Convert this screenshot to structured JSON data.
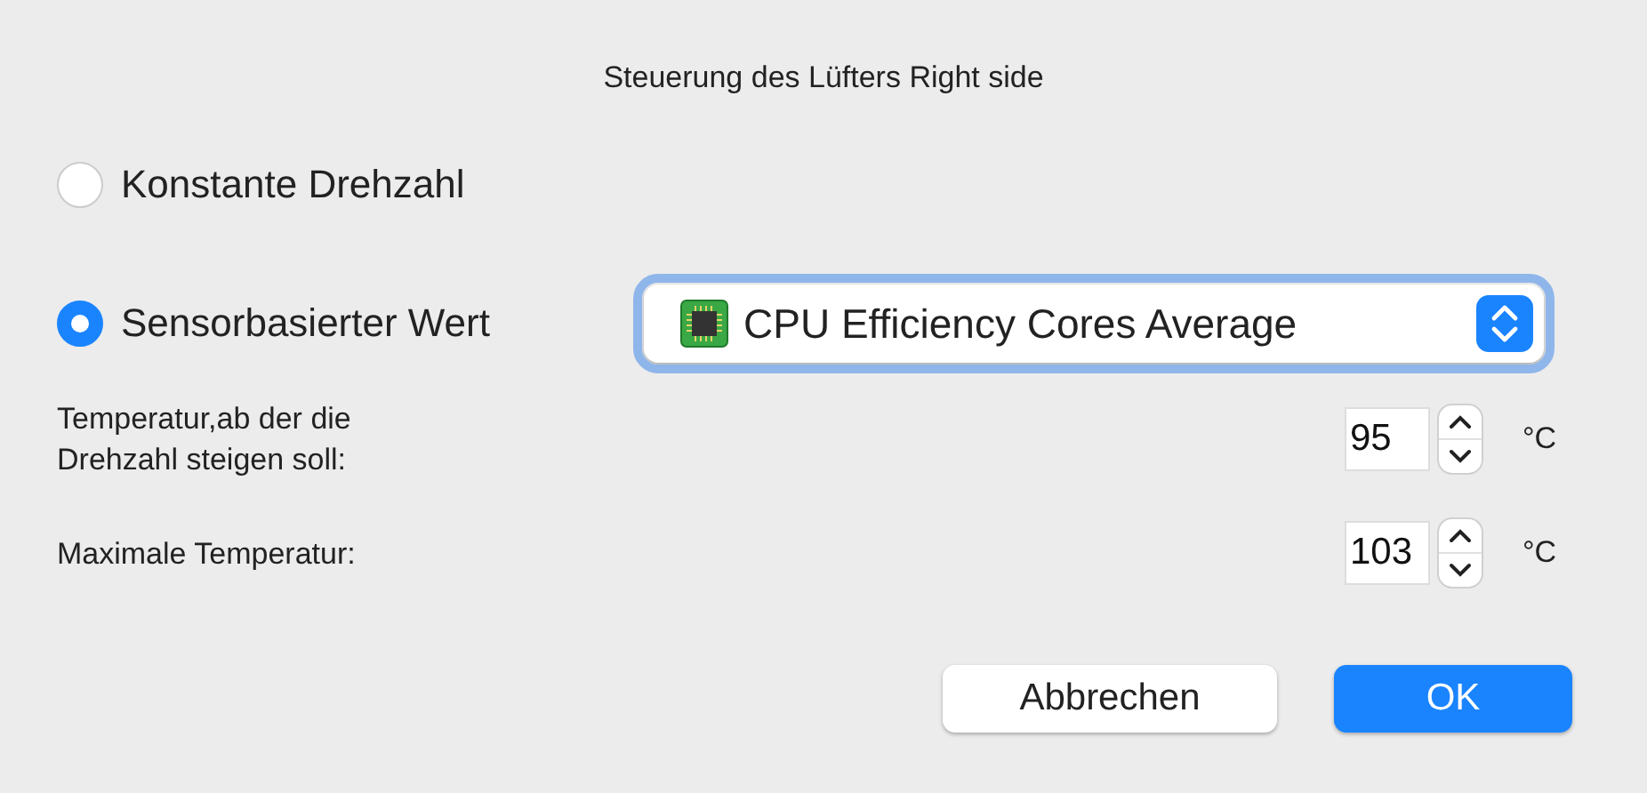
{
  "dialog": {
    "title": "Steuerung des Lüfters Right side"
  },
  "options": [
    {
      "label": "Konstante Drehzahl",
      "selected": false
    },
    {
      "label": "Sensorbasierter Wert",
      "selected": true
    }
  ],
  "sensor_popup": {
    "value": "CPU Efficiency Cores Average",
    "focused": true
  },
  "temperatures": [
    {
      "label": "Temperatur,ab der die\nDrehzahl steigen soll:",
      "value": "95",
      "unit": "°C"
    },
    {
      "label": "Maximale Temperatur:",
      "value": "103",
      "unit": "°C"
    }
  ],
  "buttons": [
    {
      "label": "Abbrechen",
      "kind": "cancel"
    },
    {
      "label": "OK",
      "kind": "default"
    }
  ]
}
